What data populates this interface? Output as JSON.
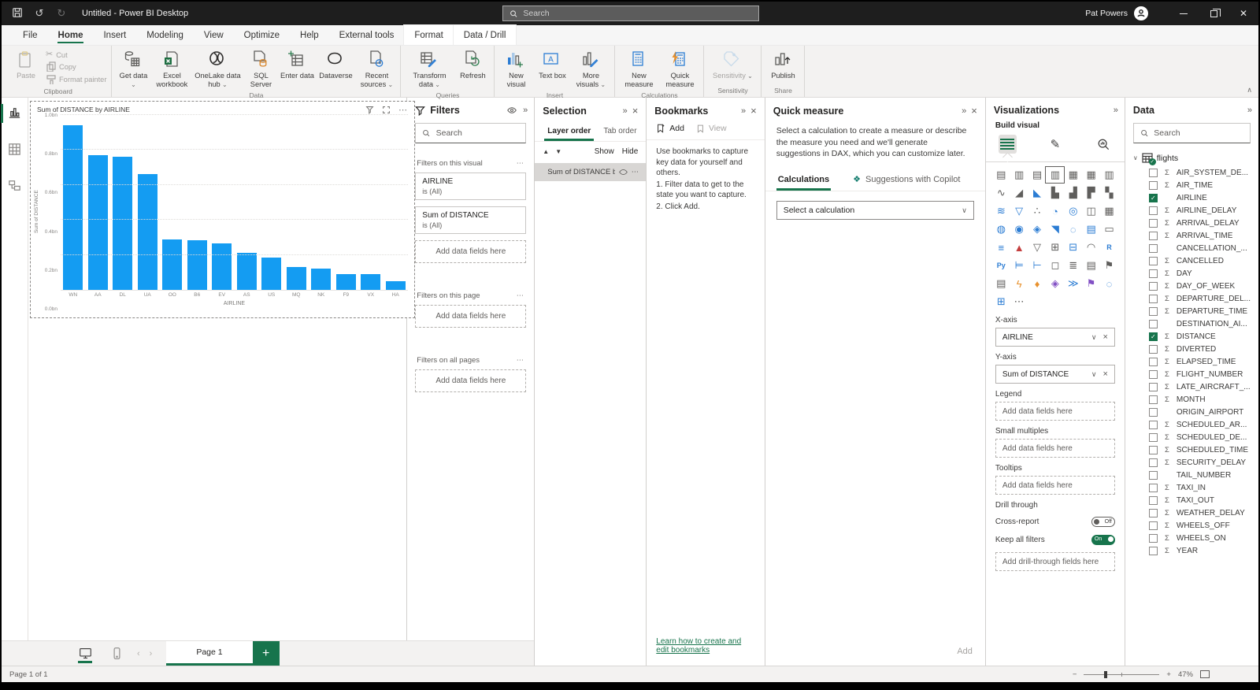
{
  "colors": {
    "accent_green": "#17744C",
    "bar_blue": "#149CF2",
    "titlebar_bg": "#1E1E1E",
    "copilot_teal": "#0E7A6B"
  },
  "window": {
    "title": "Untitled - Power BI Desktop",
    "user": "Pat Powers"
  },
  "titlebar": {
    "search_placeholder": "Search"
  },
  "menu_tabs": [
    {
      "label": "File"
    },
    {
      "label": "Home",
      "active": true
    },
    {
      "label": "Insert"
    },
    {
      "label": "Modeling"
    },
    {
      "label": "View"
    },
    {
      "label": "Optimize"
    },
    {
      "label": "Help"
    },
    {
      "label": "External tools"
    },
    {
      "label": "Format",
      "contextual": true
    },
    {
      "label": "Data / Drill",
      "contextual": true
    }
  ],
  "ribbon": {
    "groups": [
      {
        "caption": "Clipboard",
        "buttons": [
          {
            "label": "Paste",
            "disabled": true
          },
          {
            "label": "Cut",
            "disabled": true
          },
          {
            "label": "Copy",
            "disabled": true
          },
          {
            "label": "Format painter",
            "disabled": true
          }
        ]
      },
      {
        "caption": "Data",
        "buttons": [
          {
            "label": "Get data",
            "dropdown": true
          },
          {
            "label": "Excel workbook"
          },
          {
            "label": "OneLake data hub",
            "dropdown": true
          },
          {
            "label": "SQL Server"
          },
          {
            "label": "Enter data"
          },
          {
            "label": "Dataverse"
          },
          {
            "label": "Recent sources",
            "dropdown": true
          }
        ]
      },
      {
        "caption": "Queries",
        "buttons": [
          {
            "label": "Transform data",
            "dropdown": true
          },
          {
            "label": "Refresh"
          }
        ]
      },
      {
        "caption": "Insert",
        "buttons": [
          {
            "label": "New visual"
          },
          {
            "label": "Text box"
          },
          {
            "label": "More visuals",
            "dropdown": true
          }
        ]
      },
      {
        "caption": "Calculations",
        "buttons": [
          {
            "label": "New measure"
          },
          {
            "label": "Quick measure"
          }
        ]
      },
      {
        "caption": "Sensitivity",
        "buttons": [
          {
            "label": "Sensitivity",
            "dropdown": true,
            "disabled": true
          }
        ]
      },
      {
        "caption": "Share",
        "buttons": [
          {
            "label": "Publish"
          }
        ]
      }
    ]
  },
  "canvas": {
    "visual": {
      "chart_data": {
        "type": "bar",
        "title": "Sum of DISTANCE by AIRLINE",
        "categories": [
          "WN",
          "AA",
          "DL",
          "UA",
          "OO",
          "B6",
          "EV",
          "AS",
          "US",
          "MQ",
          "NK",
          "F9",
          "VX",
          "HA"
        ],
        "values": [
          0.94,
          0.77,
          0.76,
          0.66,
          0.29,
          0.285,
          0.265,
          0.21,
          0.185,
          0.13,
          0.12,
          0.09,
          0.09,
          0.05
        ],
        "value_unit": "bn",
        "xlabel": "AIRLINE",
        "ylabel": "Sum of DISTANCE",
        "ylim": [
          0,
          1.0
        ],
        "yticks": [
          "0.0bn",
          "0.2bn",
          "0.4bn",
          "0.6bn",
          "0.8bn",
          "1.0bn"
        ],
        "grid": "dotted-horizontal",
        "legend": "none",
        "bar_color": "#149CF2"
      }
    }
  },
  "filters_pane": {
    "title": "Filters",
    "search_placeholder": "Search",
    "sections": [
      {
        "title": "Filters on this visual",
        "cards": [
          {
            "field": "AIRLINE",
            "condition": "is (All)"
          },
          {
            "field": "Sum of DISTANCE",
            "condition": "is (All)"
          }
        ],
        "add_placeholder": "Add data fields here"
      },
      {
        "title": "Filters on this page",
        "cards": [],
        "add_placeholder": "Add data fields here"
      },
      {
        "title": "Filters on all pages",
        "cards": [],
        "add_placeholder": "Add data fields here"
      }
    ]
  },
  "selection_pane": {
    "title": "Selection",
    "tabs": [
      {
        "label": "Layer order",
        "active": true
      },
      {
        "label": "Tab order"
      }
    ],
    "show_label": "Show",
    "hide_label": "Hide",
    "items": [
      {
        "label": "Sum of DISTANCE by ..."
      }
    ]
  },
  "bookmarks_pane": {
    "title": "Bookmarks",
    "add_label": "Add",
    "view_label": "View",
    "instructions": [
      "Use bookmarks to capture key data for yourself and others.",
      "1. Filter data to get to the state you want to capture.",
      "2. Click Add."
    ],
    "footer_link": "Learn how to create and edit bookmarks"
  },
  "quick_measure_pane": {
    "title": "Quick measure",
    "description": "Select a calculation to create a measure or describe the measure you need and we'll generate suggestions in DAX, which you can customize later.",
    "tabs": [
      {
        "label": "Calculations",
        "active": true
      },
      {
        "label": "Suggestions with Copilot"
      }
    ],
    "select_placeholder": "Select a calculation",
    "add_label": "Add"
  },
  "visualizations_pane": {
    "title": "Visualizations",
    "build_label": "Build visual",
    "modes": [
      {
        "name": "build-visual",
        "selected": true
      },
      {
        "name": "format-visual"
      },
      {
        "name": "add-analytics"
      }
    ],
    "grid": [
      {
        "name": "stacked-bar-chart",
        "glyph": "▤",
        "color": "gray"
      },
      {
        "name": "stacked-column-chart",
        "glyph": "▥",
        "color": "gray"
      },
      {
        "name": "clustered-bar-chart",
        "glyph": "▤",
        "color": "gray"
      },
      {
        "name": "clustered-column-chart",
        "glyph": "▥",
        "color": "gray",
        "selected": true
      },
      {
        "name": "100-stacked-bar-chart",
        "glyph": "▦",
        "color": "gray"
      },
      {
        "name": "100-stacked-column-chart",
        "glyph": "▦",
        "color": "gray"
      },
      {
        "name": "small-multiples",
        "glyph": "▥",
        "color": "gray"
      },
      {
        "name": "line-chart",
        "glyph": "∿",
        "color": "gray"
      },
      {
        "name": "area-chart",
        "glyph": "◢",
        "color": "gray"
      },
      {
        "name": "stacked-area-chart",
        "glyph": "◣",
        "color": "blue"
      },
      {
        "name": "line-and-stacked-column-chart",
        "glyph": "▙",
        "color": "gray"
      },
      {
        "name": "line-and-clustered-column-chart",
        "glyph": "▟",
        "color": "gray"
      },
      {
        "name": "waterfall-chart",
        "glyph": "▛",
        "color": "gray"
      },
      {
        "name": "combo-chart",
        "glyph": "▚",
        "color": "gray"
      },
      {
        "name": "ribbon-chart",
        "glyph": "≋",
        "color": "blue"
      },
      {
        "name": "funnel-chart",
        "glyph": "▽",
        "color": "blue"
      },
      {
        "name": "scatter-chart",
        "glyph": "∴",
        "color": "gray"
      },
      {
        "name": "pie-chart",
        "glyph": "◔",
        "color": "blue"
      },
      {
        "name": "donut-chart",
        "glyph": "◎",
        "color": "blue"
      },
      {
        "name": "treemap",
        "glyph": "◫",
        "color": "gray"
      },
      {
        "name": "multi-row-card",
        "glyph": "▦",
        "color": "gray"
      },
      {
        "name": "map",
        "glyph": "◍",
        "color": "blue"
      },
      {
        "name": "filled-map",
        "glyph": "◉",
        "color": "blue"
      },
      {
        "name": "shape-map",
        "glyph": "◈",
        "color": "blue"
      },
      {
        "name": "azure-map",
        "glyph": "◥",
        "color": "blue"
      },
      {
        "name": "arcgis-map",
        "glyph": "◌",
        "color": "blue"
      },
      {
        "name": "slicer",
        "glyph": "▤",
        "color": "blue"
      },
      {
        "name": "card",
        "glyph": "▭",
        "color": "gray"
      },
      {
        "name": "text-slicer",
        "glyph": "≡",
        "color": "blue"
      },
      {
        "name": "kpi",
        "glyph": "▲",
        "color": "red"
      },
      {
        "name": "smart-filter",
        "glyph": "▽",
        "color": "gray"
      },
      {
        "name": "table",
        "glyph": "⊞",
        "color": "gray"
      },
      {
        "name": "matrix",
        "glyph": "⊟",
        "color": "blue"
      },
      {
        "name": "gauge",
        "glyph": "◠",
        "color": "gray"
      },
      {
        "name": "r-script-visual",
        "glyph": "R",
        "color": "blue",
        "text": true
      },
      {
        "name": "python-visual",
        "glyph": "Py",
        "color": "blue",
        "text": true
      },
      {
        "name": "key-influencers",
        "glyph": "⊨",
        "color": "blue"
      },
      {
        "name": "decomposition-tree",
        "glyph": "⊢",
        "color": "blue"
      },
      {
        "name": "qa-visual",
        "glyph": "◻",
        "color": "gray"
      },
      {
        "name": "smart-narrative",
        "glyph": "≣",
        "color": "gray"
      },
      {
        "name": "paginated-report",
        "glyph": "▤",
        "color": "gray"
      },
      {
        "name": "metrics",
        "glyph": "⚑",
        "color": "gray"
      },
      {
        "name": "report-visual",
        "glyph": "▤",
        "color": "gray"
      },
      {
        "name": "power-automate",
        "glyph": "ϟ",
        "color": "orange"
      },
      {
        "name": "pin-map",
        "glyph": "♦",
        "color": "orange"
      },
      {
        "name": "premium-metrics",
        "glyph": "◈",
        "color": "purple"
      },
      {
        "name": "power-apps",
        "glyph": "≫",
        "color": "blue"
      },
      {
        "name": "goals",
        "glyph": "⚑",
        "color": "purple"
      },
      {
        "name": "search-visual",
        "glyph": "◌",
        "color": "blue"
      },
      {
        "name": "get-more-visuals",
        "glyph": "⊞",
        "color": "multi"
      },
      {
        "name": "more-options",
        "glyph": "⋯",
        "color": "gray"
      }
    ],
    "wells": [
      {
        "label": "X-axis",
        "value": "AIRLINE"
      },
      {
        "label": "Y-axis",
        "value": "Sum of DISTANCE"
      },
      {
        "label": "Legend",
        "placeholder": "Add data fields here"
      },
      {
        "label": "Small multiples",
        "placeholder": "Add data fields here"
      },
      {
        "label": "Tooltips",
        "placeholder": "Add data fields here"
      }
    ],
    "drill": {
      "title": "Drill through",
      "cross_report_label": "Cross-report",
      "cross_report_state": "Off",
      "keep_filters_label": "Keep all filters",
      "keep_filters_state": "On",
      "placeholder": "Add drill-through fields here"
    }
  },
  "data_pane": {
    "title": "Data",
    "search_placeholder": "Search",
    "table": {
      "name": "flights"
    },
    "fields": [
      {
        "label": "AIR_SYSTEM_DE...",
        "sigma": true
      },
      {
        "label": "AIR_TIME",
        "sigma": true
      },
      {
        "label": "AIRLINE",
        "sigma": false,
        "checked": true
      },
      {
        "label": "AIRLINE_DELAY",
        "sigma": true
      },
      {
        "label": "ARRIVAL_DELAY",
        "sigma": true
      },
      {
        "label": "ARRIVAL_TIME",
        "sigma": true
      },
      {
        "label": "CANCELLATION_...",
        "sigma": false
      },
      {
        "label": "CANCELLED",
        "sigma": true
      },
      {
        "label": "DAY",
        "sigma": true
      },
      {
        "label": "DAY_OF_WEEK",
        "sigma": true
      },
      {
        "label": "DEPARTURE_DEL...",
        "sigma": true
      },
      {
        "label": "DEPARTURE_TIME",
        "sigma": true
      },
      {
        "label": "DESTINATION_AI...",
        "sigma": false
      },
      {
        "label": "DISTANCE",
        "sigma": true,
        "checked": true
      },
      {
        "label": "DIVERTED",
        "sigma": true
      },
      {
        "label": "ELAPSED_TIME",
        "sigma": true
      },
      {
        "label": "FLIGHT_NUMBER",
        "sigma": true
      },
      {
        "label": "LATE_AIRCRAFT_...",
        "sigma": true
      },
      {
        "label": "MONTH",
        "sigma": true
      },
      {
        "label": "ORIGIN_AIRPORT",
        "sigma": false
      },
      {
        "label": "SCHEDULED_AR...",
        "sigma": true
      },
      {
        "label": "SCHEDULED_DE...",
        "sigma": true
      },
      {
        "label": "SCHEDULED_TIME",
        "sigma": true
      },
      {
        "label": "SECURITY_DELAY",
        "sigma": true
      },
      {
        "label": "TAIL_NUMBER",
        "sigma": false
      },
      {
        "label": "TAXI_IN",
        "sigma": true
      },
      {
        "label": "TAXI_OUT",
        "sigma": true
      },
      {
        "label": "WEATHER_DELAY",
        "sigma": true
      },
      {
        "label": "WHEELS_OFF",
        "sigma": true
      },
      {
        "label": "WHEELS_ON",
        "sigma": true
      },
      {
        "label": "YEAR",
        "sigma": true
      }
    ]
  },
  "page_bar": {
    "page_tab_label": "Page 1"
  },
  "status_bar": {
    "page_indicator": "Page 1 of 1",
    "zoom_level": "47%"
  }
}
